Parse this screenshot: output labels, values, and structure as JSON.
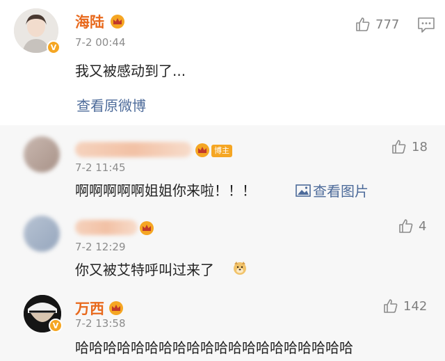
{
  "main_post": {
    "username": "海陆",
    "verified_mark": "V",
    "timestamp": "7-2 00:44",
    "likes": "777",
    "text": "我又被感动到了...",
    "view_original_link": "查看原微博",
    "icons": {
      "crown": "crown-icon",
      "like": "thumbs-up-icon",
      "comment": "comment-icon"
    }
  },
  "comments": [
    {
      "username": "",
      "badge": "博主",
      "timestamp": "7-2 11:45",
      "likes": "18",
      "text": "啊啊啊啊啊姐姐你来啦！！！",
      "view_picture_link": "查看图片"
    },
    {
      "username": "",
      "timestamp": "7-2 12:29",
      "likes": "4",
      "text": "你又被艾特呼叫过来了"
    },
    {
      "username": "万西",
      "verified_mark": "V",
      "timestamp": "7-2 13:58",
      "likes": "142",
      "text": "哈哈哈哈哈哈哈哈哈哈哈哈哈哈哈哈哈哈哈哈"
    }
  ],
  "colors": {
    "username_orange": "#e8691d",
    "link_blue": "#4d6b9a",
    "comment_bg": "#f7f7f7",
    "badge_gold": "#f5a623"
  }
}
